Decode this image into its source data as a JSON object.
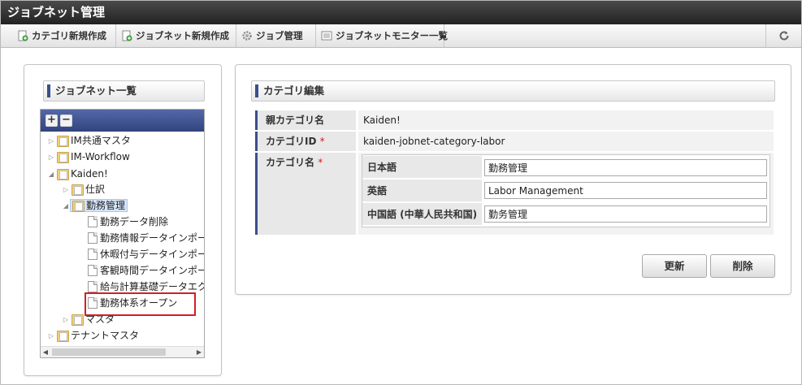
{
  "app_title": "ジョブネット管理",
  "toolbar": {
    "items": [
      "カテゴリ新規作成",
      "ジョブネット新規作成",
      "ジョブ管理",
      "ジョブネットモニター一覧"
    ],
    "refresh_icon": "refresh-icon"
  },
  "left_panel": {
    "title": "ジョブネット一覧",
    "tree_buttons": [
      "+",
      "−"
    ],
    "tree": [
      {
        "label": "IM共通マスタ",
        "type": "folder",
        "state": "collapsed"
      },
      {
        "label": "IM-Workflow",
        "type": "folder",
        "state": "collapsed"
      },
      {
        "label": "Kaiden!",
        "type": "folder",
        "state": "expanded"
      },
      {
        "label": "仕訳",
        "type": "folder",
        "state": "collapsed"
      },
      {
        "label": "勤務管理",
        "type": "folder",
        "state": "expanded",
        "selected": true
      },
      {
        "label": "勤務データ削除",
        "type": "doc"
      },
      {
        "label": "勤務情報データインポー",
        "type": "doc"
      },
      {
        "label": "休暇付与データインポー",
        "type": "doc"
      },
      {
        "label": "客観時間データインポー",
        "type": "doc"
      },
      {
        "label": "給与計算基礎データエク",
        "type": "doc"
      },
      {
        "label": "勤務体系オープン",
        "type": "doc"
      },
      {
        "label": "マスタ",
        "type": "folder",
        "state": "collapsed"
      },
      {
        "label": "テナントマスタ",
        "type": "folder",
        "state": "collapsed"
      }
    ]
  },
  "right_panel": {
    "title": "カテゴリ編集",
    "parent_category_label": "親カテゴリ名",
    "parent_category_value": "Kaiden!",
    "category_id_label": "カテゴリID",
    "category_id_value": "kaiden-jobnet-category-labor",
    "category_name_label": "カテゴリ名",
    "required_mark": "*",
    "names": [
      {
        "lang": "日本語",
        "value": "勤務管理"
      },
      {
        "lang": "英語",
        "value": "Labor Management"
      },
      {
        "lang": "中国語 (中華人民共和国)",
        "value": "勤务管理"
      }
    ],
    "update_button": "更新",
    "delete_button": "削除"
  }
}
